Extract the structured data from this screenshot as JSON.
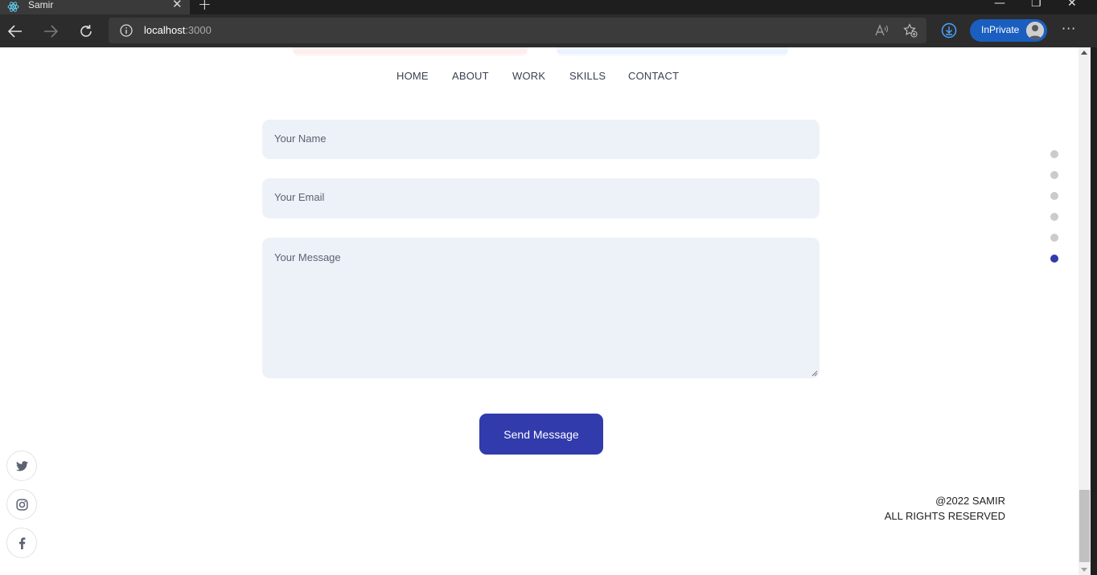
{
  "browser": {
    "tab_title": "Samir",
    "url_host": "localhost",
    "url_port": ":3000",
    "inprivate_label": "InPrivate"
  },
  "nav": {
    "items": [
      "HOME",
      "ABOUT",
      "WORK",
      "SKILLS",
      "CONTACT"
    ]
  },
  "form": {
    "name_placeholder": "Your Name",
    "email_placeholder": "Your Email",
    "message_placeholder": "Your Message",
    "submit_label": "Send Message"
  },
  "section_dots": {
    "count": 6,
    "active_index": 5
  },
  "social": [
    "twitter-icon",
    "instagram-icon",
    "facebook-icon"
  ],
  "footer": {
    "line1": "@2022 SAMIR",
    "line2": "ALL RIGHTS RESERVED"
  },
  "colors": {
    "accent": "#313bac",
    "input_bg": "#edf1f8",
    "dot_inactive": "#cbcbcb"
  }
}
